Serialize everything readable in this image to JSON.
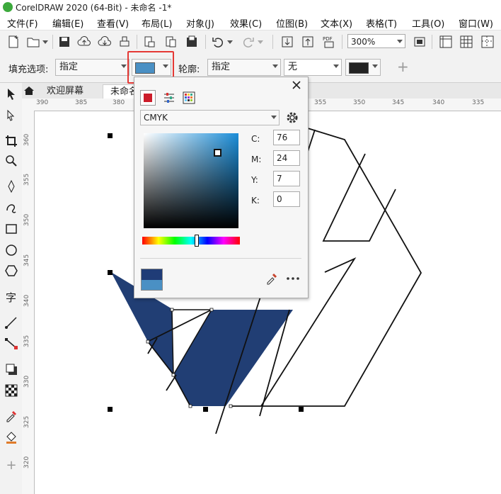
{
  "window": {
    "title": "CorelDRAW 2020 (64-Bit) - 未命名 -1*"
  },
  "menubar": {
    "items": [
      "文件(F)",
      "编辑(E)",
      "查看(V)",
      "布局(L)",
      "对象(J)",
      "效果(C)",
      "位图(B)",
      "文本(X)",
      "表格(T)",
      "工具(O)",
      "窗口(W)"
    ]
  },
  "toolbar": {
    "zoom": "300%"
  },
  "propbar": {
    "fill_label": "填充选项:",
    "fill_mode": "指定",
    "fill_color": "#4a90c4",
    "outline_label": "轮廓:",
    "outline_mode": "指定",
    "outline_width": "无",
    "outline_color": "#222222",
    "add": "+"
  },
  "tabs": {
    "welcome": "欢迎屏幕",
    "doc": "未命名"
  },
  "rulers": {
    "h_ticks": [
      "390",
      "385",
      "380",
      "355",
      "350",
      "345",
      "340",
      "335"
    ],
    "v_ticks": [
      "360",
      "355",
      "350",
      "345",
      "340",
      "335",
      "330",
      "325",
      "320"
    ]
  },
  "color_popup": {
    "model": "CMYK",
    "c_label": "C:",
    "c": "76",
    "m_label": "M:",
    "m": "24",
    "y_label": "Y:",
    "y": "7",
    "k_label": "K:",
    "k": "0",
    "new_color": "#1f3c77",
    "old_color": "#4a90c4"
  },
  "canvas": {
    "shape_fill": "#213e74",
    "stroke": "#111111"
  }
}
